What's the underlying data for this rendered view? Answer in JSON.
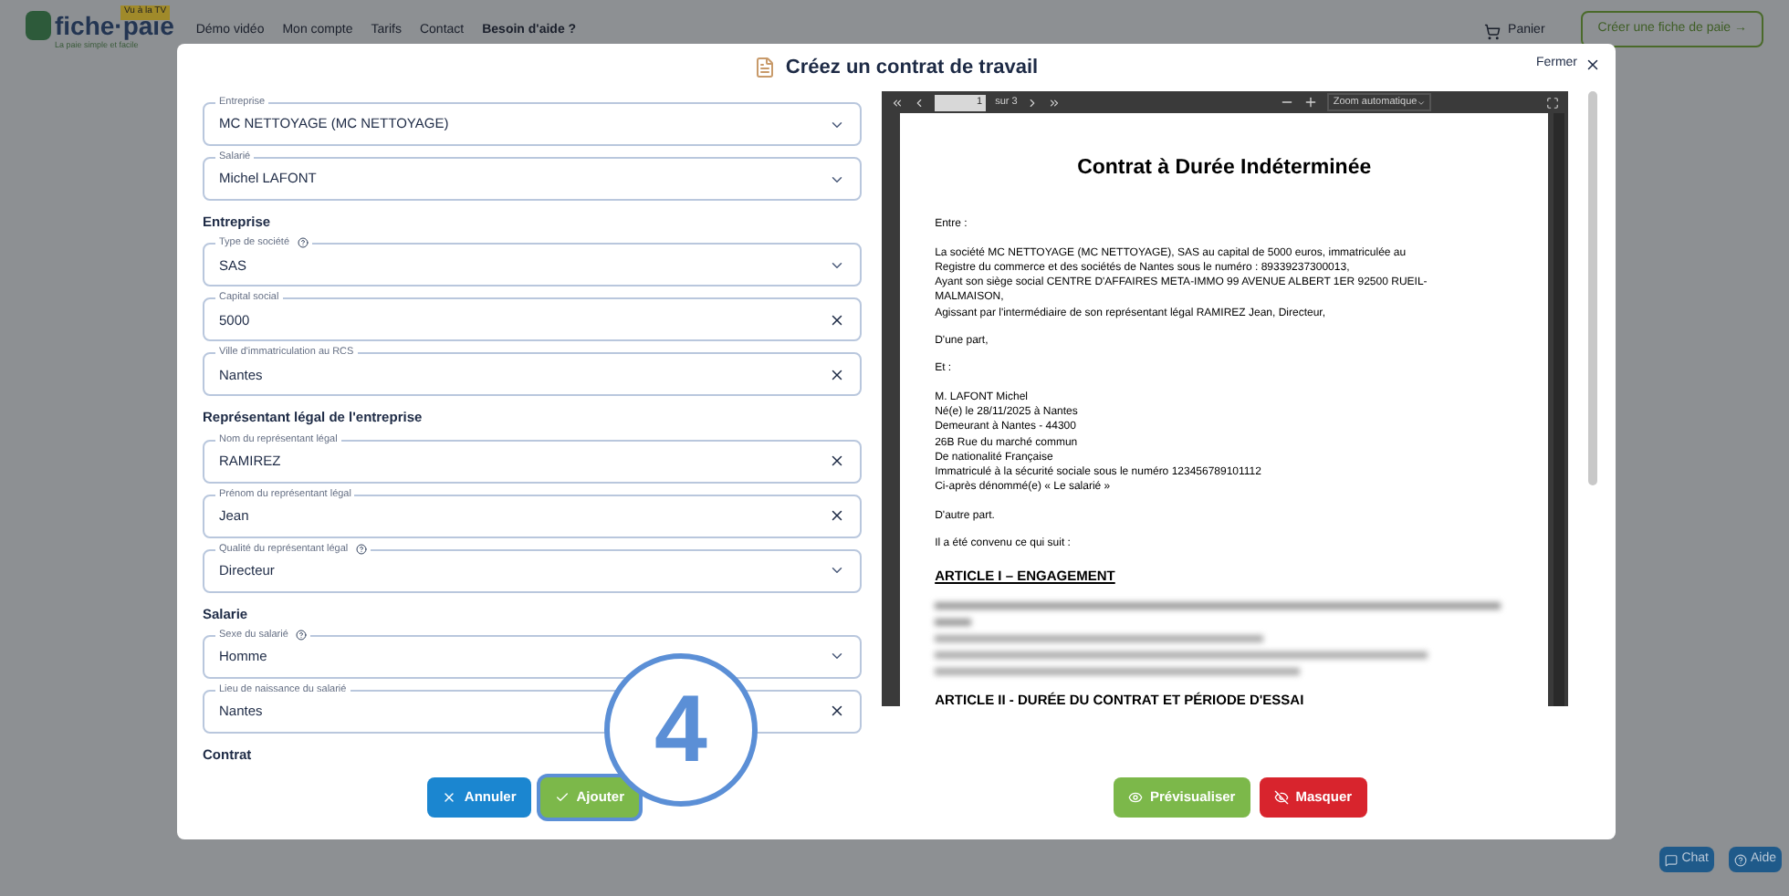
{
  "site": {
    "logo": "fiche·paie",
    "logo_badge": "Vu à la TV",
    "logo_tagline": "La paie simple et facile",
    "nav": [
      {
        "label": "Démo vidéo",
        "bold": false
      },
      {
        "label": "Mon compte",
        "bold": false
      },
      {
        "label": "Tarifs",
        "bold": false
      },
      {
        "label": "Contact",
        "bold": false
      },
      {
        "label": "Besoin d'aide ?",
        "bold": true
      }
    ],
    "cart": "Panier",
    "cta": "Créer une fiche de paie →"
  },
  "modal": {
    "title": "Créez un contrat de travail",
    "close": "Fermer",
    "sections": [
      {
        "fields": [
          {
            "label": "Entreprise",
            "value": "MC NETTOYAGE (MC NETTOYAGE)",
            "kind": "select",
            "help": false
          },
          {
            "label": "Salarié",
            "value": "Michel LAFONT",
            "kind": "select",
            "help": false
          }
        ]
      },
      {
        "heading": "Entreprise",
        "fields": [
          {
            "label": "Type de société",
            "value": "SAS",
            "kind": "select",
            "help": true
          },
          {
            "label": "Capital social",
            "value": "5000",
            "kind": "text",
            "help": false
          },
          {
            "label": "Ville d'immatriculation au RCS",
            "value": "Nantes",
            "kind": "text",
            "help": false
          }
        ]
      },
      {
        "heading": "Représentant légal de l'entreprise",
        "fields": [
          {
            "label": "Nom du représentant légal",
            "value": "RAMIREZ",
            "kind": "text",
            "help": false
          },
          {
            "label": "Prénom du représentant légal",
            "value": "Jean",
            "kind": "text",
            "help": false
          },
          {
            "label": "Qualité du représentant légal",
            "value": "Directeur",
            "kind": "select",
            "help": true
          }
        ]
      },
      {
        "heading": "Salarie",
        "fields": [
          {
            "label": "Sexe du salarié",
            "value": "Homme",
            "kind": "select",
            "help": true
          },
          {
            "label": "Lieu de naissance du salarié",
            "value": "Nantes",
            "kind": "text",
            "help": false
          }
        ]
      },
      {
        "heading": "Contrat"
      }
    ],
    "viewer": {
      "page": "1",
      "page_count": "sur 3",
      "zoom": "Zoom automatique"
    },
    "document": {
      "title": "Contrat à Durée Indéterminée",
      "blocks": [
        {
          "kind": "text",
          "lines": [
            "Entre :"
          ]
        },
        {
          "kind": "text",
          "lines": [
            "La société MC NETTOYAGE (MC NETTOYAGE), SAS au capital de 5000 euros, immatriculée au",
            "Registre du commerce et des sociétés de Nantes sous le numéro : 89339237300013,",
            "Ayant son siège social CENTRE D'AFFAIRES META-IMMO 99 AVENUE ALBERT 1ER 92500 RUEIL-",
            "MALMAISON,",
            "Agissant par l'intermédiaire de son représentant légal RAMIREZ Jean, Directeur,"
          ]
        },
        {
          "kind": "text",
          "lines": [
            "D'une part,"
          ]
        },
        {
          "kind": "text",
          "lines": [
            "Et :"
          ]
        },
        {
          "kind": "text",
          "lines": [
            "M. LAFONT Michel",
            "Né(e) le 28/11/2025 à Nantes",
            "Demeurant à Nantes - 44300",
            "26B Rue du marché commun",
            "De nationalité Française",
            "Immatriculé à la sécurité sociale sous le numéro 123456789101112",
            "Ci-après dénommé(e) « Le salarié »"
          ]
        },
        {
          "kind": "text",
          "lines": [
            "D'autre part."
          ]
        },
        {
          "kind": "text",
          "lines": [
            "Il a été convenu ce qui suit :"
          ]
        },
        {
          "kind": "heading",
          "lines": [
            "ARTICLE I – ENGAGEMENT"
          ],
          "underline": true
        },
        {
          "kind": "blurred"
        },
        {
          "kind": "heading",
          "lines": [
            "ARTICLE II - DURÉE DU CONTRAT ET PÉRIODE D'ESSAI"
          ]
        }
      ]
    },
    "buttons": [
      {
        "label": "Annuler",
        "kind": "cancel",
        "highlighted": false
      },
      {
        "label": "Ajouter",
        "kind": "add",
        "highlighted": true
      },
      {
        "label": "Prévisualiser",
        "kind": "preview",
        "highlighted": false
      },
      {
        "label": "Masquer",
        "kind": "hide",
        "highlighted": false
      }
    ]
  },
  "step_badge": "4",
  "support": [
    {
      "label": "Chat",
      "kind": "chat"
    },
    {
      "label": "Aide",
      "kind": "help"
    }
  ]
}
